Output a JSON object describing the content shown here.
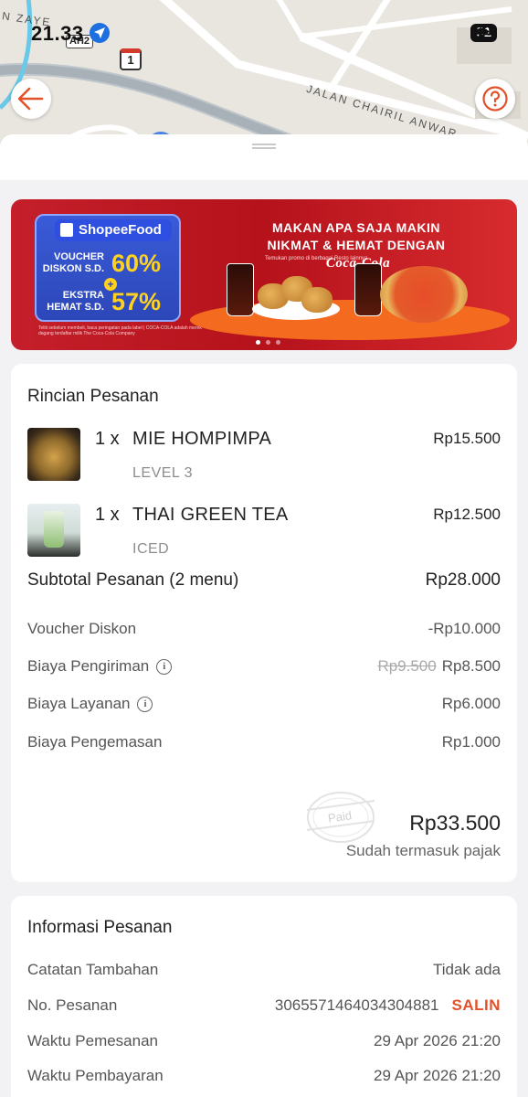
{
  "status_bar": {
    "time": "21.33",
    "battery": "81"
  },
  "map": {
    "road_label_1": "JALAN CHAIRIL ANWAR",
    "road_label_2": "N ZAYE",
    "route_badge_1": "AH2",
    "route_badge_2": "1"
  },
  "banner": {
    "brand": "ShopeeFood",
    "voucher_label": "VOUCHER DISKON S.D.",
    "voucher_pct": "60%",
    "extra_label": "EKSTRA HEMAT S.D.",
    "extra_pct": "57%",
    "headline_1": "MAKAN APA SAJA MAKIN",
    "headline_2": "NIKMAT & HEMAT DENGAN",
    "brand_partner": "Coca-Cola",
    "subnote": "Temukan promo di berbagai Resto lainnya",
    "disclaimer": "Teliti sebelum membeli, baca peringatan pada label | COCA-COLA adalah merek dagang terdaftar milik The Coca-Cola Company"
  },
  "order": {
    "title": "Rincian Pesanan",
    "items": [
      {
        "qty": "1 x",
        "name": "MIE HOMPIMPA",
        "variant": "LEVEL 3",
        "price": "Rp15.500",
        "thumb": "noodle-photo"
      },
      {
        "qty": "1 x",
        "name": "THAI GREEN TEA",
        "variant": "ICED",
        "price": "Rp12.500",
        "thumb": "green-tea-photo"
      }
    ],
    "subtotal_label": "Subtotal Pesanan (2 menu)",
    "subtotal_value": "Rp28.000",
    "rows": [
      {
        "label": "Voucher Diskon",
        "value": "-Rp10.000"
      },
      {
        "label": "Biaya Pengiriman",
        "old_value": "Rp9.500",
        "value": "Rp8.500"
      },
      {
        "label": "Biaya Layanan",
        "value": "Rp6.000"
      },
      {
        "label": "Biaya Pengemasan",
        "value": "Rp1.000"
      }
    ],
    "paid_stamp": "Paid",
    "total": "Rp33.500",
    "total_note": "Sudah termasuk pajak"
  },
  "info": {
    "title": "Informasi Pesanan",
    "rows": [
      {
        "label": "Catatan Tambahan",
        "value": "Tidak ada"
      },
      {
        "label": "No. Pesanan",
        "value": "3065571464034304881",
        "action": "SALIN"
      },
      {
        "label": "Waktu Pemesanan",
        "value": "29 Apr 2026 21:20"
      },
      {
        "label": "Waktu Pembayaran",
        "value": "29 Apr 2026 21:20"
      }
    ]
  },
  "colors": {
    "accent": "#e3512b",
    "banner_red": "#c41f2a",
    "shopee_blue": "#2f4fe0"
  }
}
